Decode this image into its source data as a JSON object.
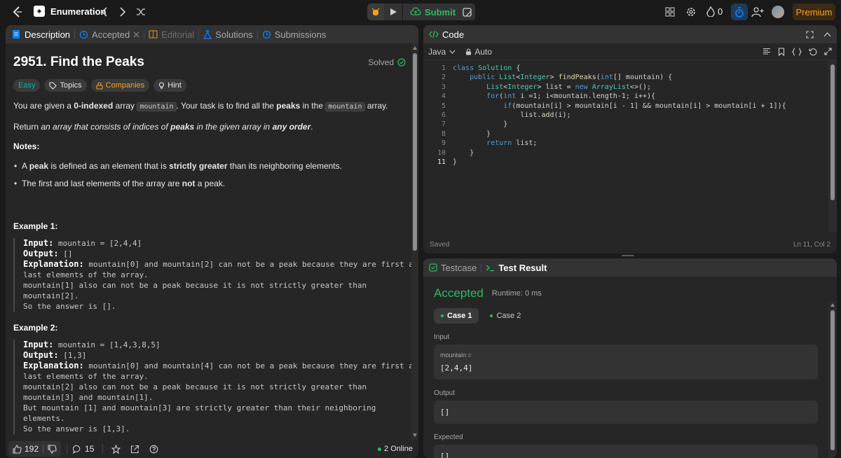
{
  "topbar": {
    "problem_list_label": "Enumeration",
    "submit_label": "Submit",
    "streak_count": "0",
    "premium_label": "Premium"
  },
  "left_tabs": {
    "description": "Description",
    "accepted": "Accepted",
    "editorial": "Editorial",
    "solutions": "Solutions",
    "submissions": "Submissions"
  },
  "problem": {
    "title": "2951. Find the Peaks",
    "status": "Solved",
    "difficulty": "Easy",
    "topics": "Topics",
    "companies": "Companies",
    "hint": "Hint",
    "p1_a": "You are given a ",
    "p1_b": "0-indexed",
    "p1_c": " array ",
    "p1_code1": "mountain",
    "p1_d": ". Your task is to find all the ",
    "p1_e": "peaks",
    "p1_f": " in the ",
    "p1_code2": "mountain",
    "p1_g": " array.",
    "p2_a": "Return ",
    "p2_b": "an array that consists of ",
    "p2_c": "indices",
    "p2_d": " of ",
    "p2_e": "peaks",
    "p2_f": " in the given array in ",
    "p2_g": "any order",
    "p2_h": ".",
    "notes_label": "Notes:",
    "note1_a": "A ",
    "note1_b": "peak",
    "note1_c": " is defined as an element that is ",
    "note1_d": "strictly greater",
    "note1_e": " than its neighboring elements.",
    "note2_a": "The first and last elements of the array are ",
    "note2_b": "not",
    "note2_c": " a peak.",
    "example1_label": "Example 1:",
    "example2_label": "Example 2:",
    "ex1": {
      "input_label": "Input:",
      "input": " mountain = [2,4,4]",
      "output_label": "Output:",
      "output": " []",
      "explanation_label": "Explanation:",
      "explanation": " mountain[0] and mountain[2] can not be a peak because they are first and\nlast elements of the array.\nmountain[1] also can not be a peak because it is not strictly greater than\nmountain[2].\nSo the answer is []."
    },
    "ex2": {
      "input_label": "Input:",
      "input": " mountain = [1,4,3,8,5]",
      "output_label": "Output:",
      "output": " [1,3]",
      "explanation_label": "Explanation:",
      "explanation": " mountain[0] and mountain[4] can not be a peak because they are first and\nlast elements of the array.\nmountain[2] also can not be a peak because it is not strictly greater than\nmountain[3] and mountain[1].\nBut mountain [1] and mountain[3] are strictly greater than their neighboring\nelements.\nSo the answer is [1,3]."
    }
  },
  "footer": {
    "likes": "192",
    "comments": "15",
    "online": "2 Online"
  },
  "code_panel": {
    "title": "Code",
    "language": "Java",
    "auto": "Auto",
    "saved": "Saved",
    "cursor": "Ln 11, Col 2",
    "lines": [
      "1",
      "2",
      "3",
      "4",
      "5",
      "6",
      "7",
      "8",
      "9",
      "10",
      "11"
    ]
  },
  "result_panel": {
    "testcase_tab": "Testcase",
    "result_tab": "Test Result",
    "verdict": "Accepted",
    "runtime": "Runtime: 0 ms",
    "case1": "Case 1",
    "case2": "Case 2",
    "input_label": "Input",
    "input_var": "mountain =",
    "input_value": "[2,4,4]",
    "output_label": "Output",
    "output_value": "[]",
    "expected_label": "Expected",
    "expected_value": "[]"
  },
  "colors": {
    "accent_green": "#2cbb5d",
    "easy_teal": "#00b8a3",
    "companies_orange": "#ffa116",
    "premium": "#ffa116",
    "link_blue": "#0a84ff"
  }
}
